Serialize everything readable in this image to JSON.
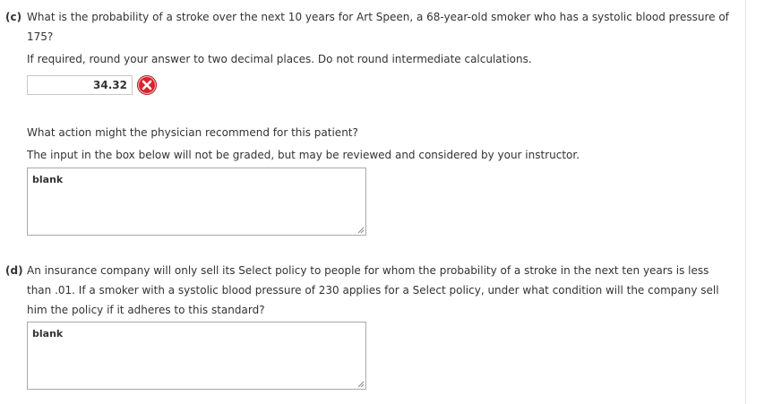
{
  "part_c": {
    "label": "(c)",
    "question_line1": "What is the probability of a stroke over the next 10 years for Art Speen, a 68-year-old smoker who has a systolic blood pressure of",
    "question_line2": "175?",
    "rounding_note": "If required, round your answer to two decimal places. Do not round intermediate calculations.",
    "answer_value": "34.32",
    "answer_status": "incorrect",
    "followup_question": "What action might the physician recommend for this patient?",
    "grading_note": "The input in the box below will not be graded, but may be reviewed and considered by your instructor.",
    "essay_value": "blank"
  },
  "part_d": {
    "label": "(d)",
    "question_line1": "An insurance company will only sell its Select policy to people for whom the probability of a stroke in the next ten years is less",
    "question_line2": "than .01. If a smoker with a systolic blood pressure of 230 applies for a Select policy, under what condition will the company sell",
    "question_line3": "him the policy if it adheres to this standard?",
    "essay_value": "blank"
  },
  "icons": {
    "incorrect": "x-circle-icon"
  },
  "colors": {
    "incorrect": "#d9232d",
    "text": "#333333"
  }
}
